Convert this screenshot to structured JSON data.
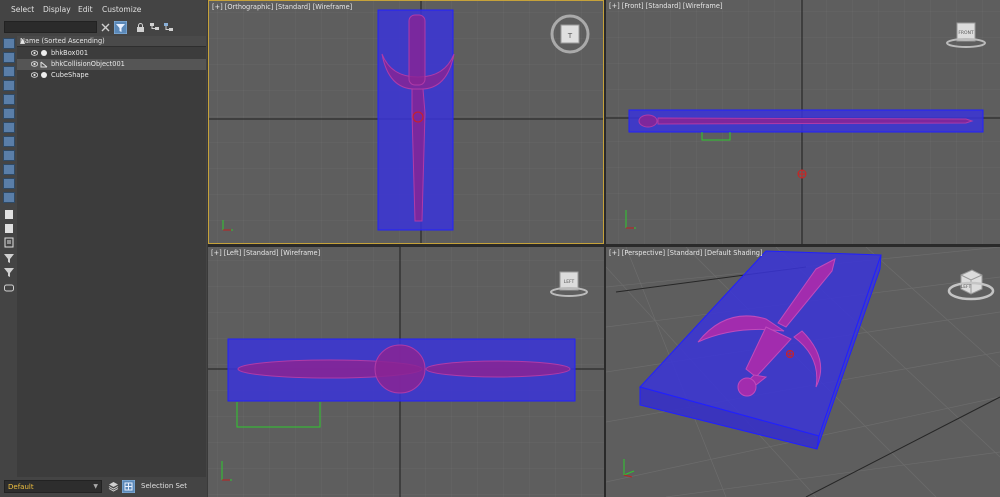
{
  "menu": {
    "select": "Select",
    "display": "Display",
    "edit": "Edit",
    "customize": "Customize"
  },
  "search": {
    "value": ""
  },
  "tree": {
    "header": "Name (Sorted Ascending)",
    "items": [
      {
        "label": "bhkBox001"
      },
      {
        "label": "bhkCollisionObject001"
      },
      {
        "label": "CubeShape"
      }
    ]
  },
  "bottom": {
    "layer": "Default",
    "selection_set": "Selection Set"
  },
  "viewports": {
    "top": "[+] [Orthographic] [Standard] [Wireframe]",
    "front": "[+] [Front] [Standard] [Wireframe]",
    "left": "[+] [Left] [Standard] [Wireframe]",
    "perspective": "[+] [Perspective] [Standard] [Default Shading]"
  },
  "viewcube": {
    "top": "T",
    "front": "FRONT",
    "left": "LEFT",
    "perspective": "LEFT"
  },
  "colors": {
    "collision_box": "#2b2bd6",
    "sword": "#a0229a",
    "active_border": "#c6a23a"
  }
}
